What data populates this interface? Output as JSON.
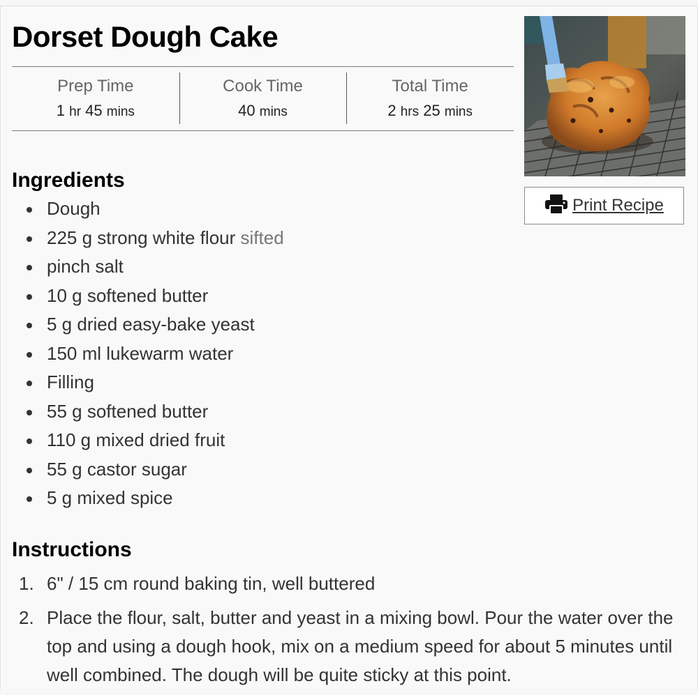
{
  "recipe": {
    "title": "Dorset Dough Cake",
    "times": [
      {
        "label": "Prep Time",
        "parts": [
          {
            "num": "1",
            "unit": "hr"
          },
          {
            "num": "45",
            "unit": "mins"
          }
        ]
      },
      {
        "label": "Cook Time",
        "parts": [
          {
            "num": "40",
            "unit": "mins"
          }
        ]
      },
      {
        "label": "Total Time",
        "parts": [
          {
            "num": "2",
            "unit": "hrs"
          },
          {
            "num": "25",
            "unit": "mins"
          }
        ]
      }
    ],
    "print_label": "Print Recipe",
    "ingredients_heading": "Ingredients",
    "ingredients": [
      {
        "text": "Dough",
        "note": ""
      },
      {
        "text": "225 g strong white flour",
        "note": "sifted"
      },
      {
        "text": "pinch salt",
        "note": ""
      },
      {
        "text": "10 g softened butter",
        "note": ""
      },
      {
        "text": "5 g dried easy-bake yeast",
        "note": ""
      },
      {
        "text": "150 ml lukewarm water",
        "note": ""
      },
      {
        "text": "Filling",
        "note": ""
      },
      {
        "text": "55 g softened butter",
        "note": ""
      },
      {
        "text": "110 g mixed dried fruit",
        "note": ""
      },
      {
        "text": "55 g castor sugar",
        "note": ""
      },
      {
        "text": "5 g mixed spice",
        "note": ""
      }
    ],
    "instructions_heading": "Instructions",
    "instructions": [
      {
        "num": "1.",
        "text": "6\" / 15 cm round baking tin, well buttered"
      },
      {
        "num": "2.",
        "text": "Place the flour, salt, butter and yeast in a mixing bowl. Pour the water over the top and using a dough hook, mix on a medium speed for about 5 minutes until well combined. The dough will be quite sticky at this point."
      }
    ]
  },
  "icons": {
    "print": "printer-icon"
  },
  "colors": {
    "background": "#f9f9f9",
    "text": "#333333",
    "muted": "#777777",
    "heading": "#000000"
  }
}
